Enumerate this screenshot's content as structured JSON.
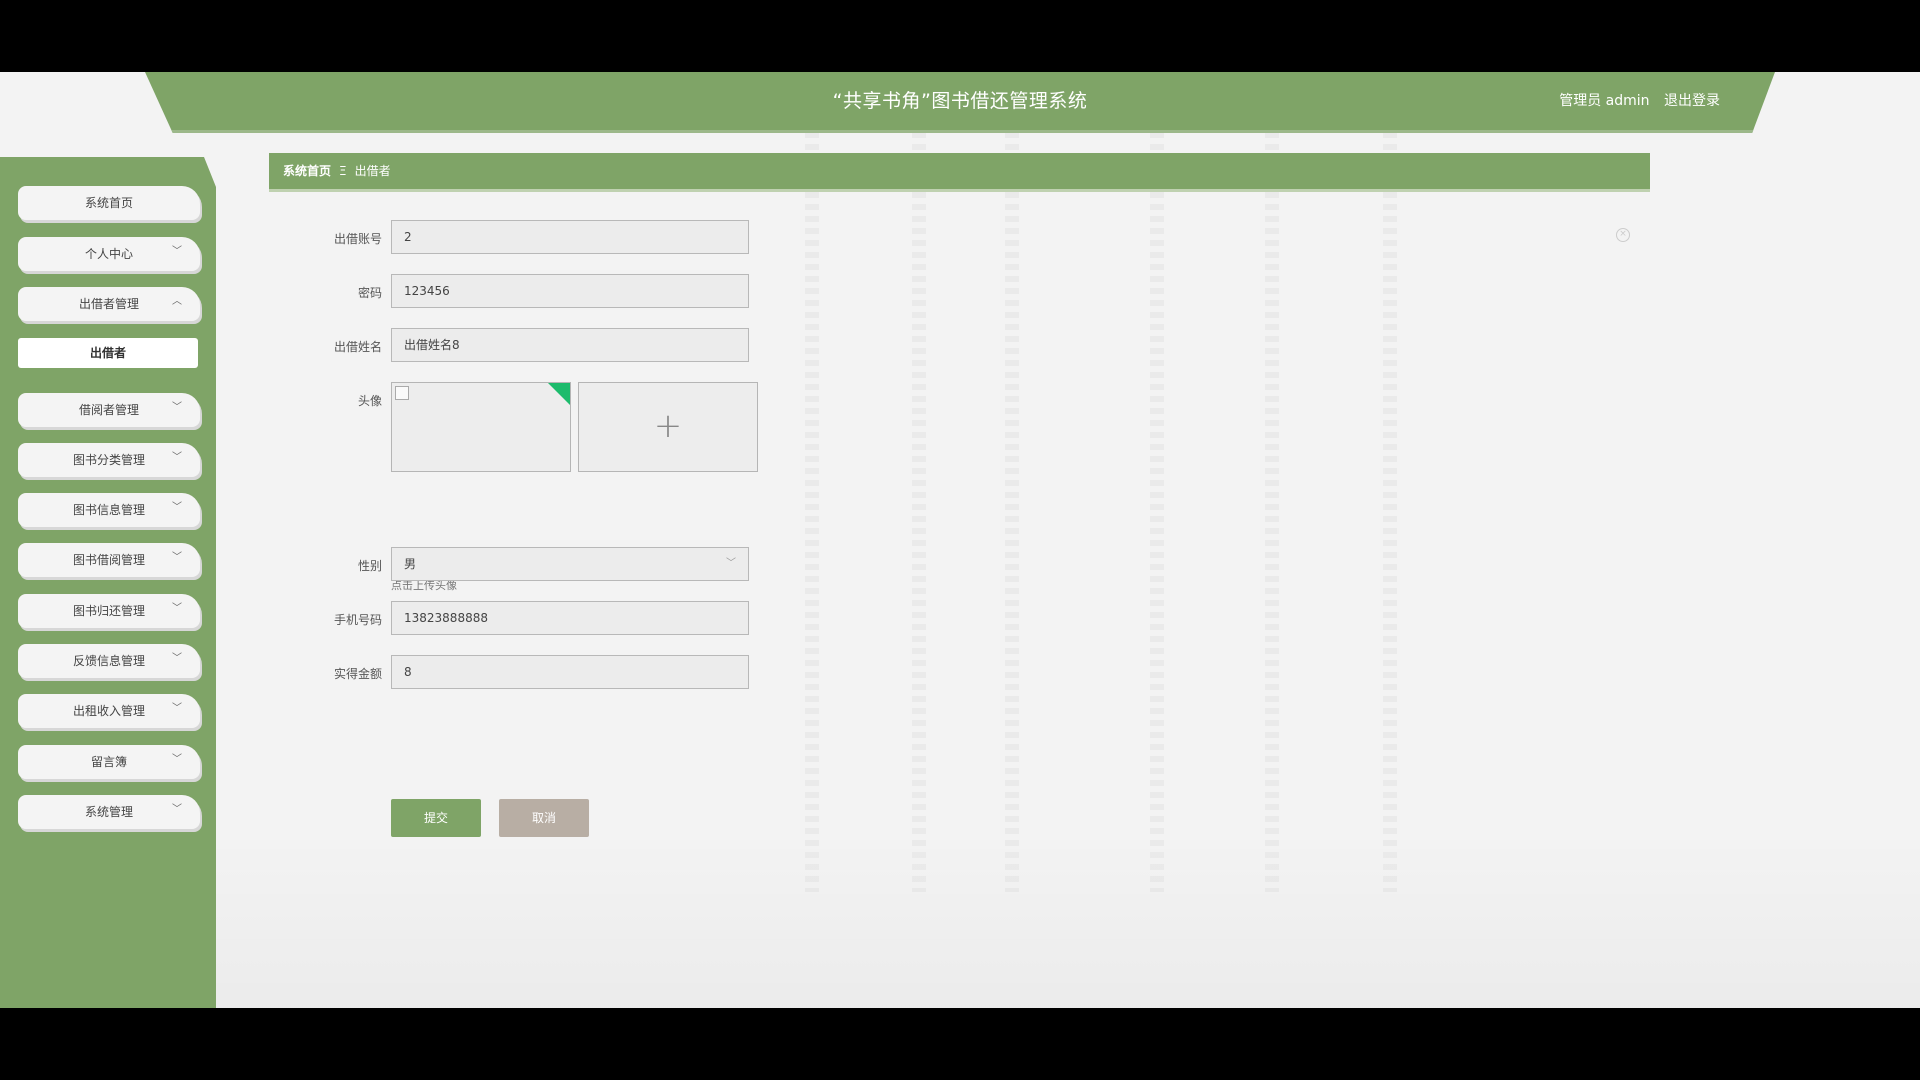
{
  "header": {
    "title": "“共享书角”图书借还管理系统",
    "user_label": "管理员 admin",
    "logout_label": "退出登录"
  },
  "sidebar": {
    "items": [
      {
        "label": "系统首页"
      },
      {
        "label": "个人中心"
      },
      {
        "label": "出借者管理"
      },
      {
        "label": "借阅者管理"
      },
      {
        "label": "图书分类管理"
      },
      {
        "label": "图书信息管理"
      },
      {
        "label": "图书借阅管理"
      },
      {
        "label": "图书归还管理"
      },
      {
        "label": "反馈信息管理"
      },
      {
        "label": "出租收入管理"
      },
      {
        "label": "留言簿"
      },
      {
        "label": "系统管理"
      }
    ],
    "sub_item": "出借者"
  },
  "breadcrumb": {
    "home": "系统首页",
    "separator": "Ξ",
    "current": "出借者"
  },
  "form": {
    "account_label": "出借账号",
    "account_value": "2",
    "password_label": "密码",
    "password_value": "123456",
    "name_label": "出借姓名",
    "name_value": "出借姓名8",
    "avatar_label": "头像",
    "avatar_tip": "点击上传头像",
    "gender_label": "性别",
    "gender_value": "男",
    "phone_label": "手机号码",
    "phone_value": "13823888888",
    "amount_label": "实得金额",
    "amount_value": "8",
    "submit_label": "提交",
    "cancel_label": "取消"
  },
  "colors": {
    "brand_green": "#7fa467",
    "cancel_brown": "#b8aea4",
    "upload_corner": "#1dbb6c"
  },
  "icons": {
    "chevron_down": "chevron-down-icon",
    "chevron_up": "chevron-up-icon",
    "plus": "plus-icon",
    "close": "close-icon"
  }
}
